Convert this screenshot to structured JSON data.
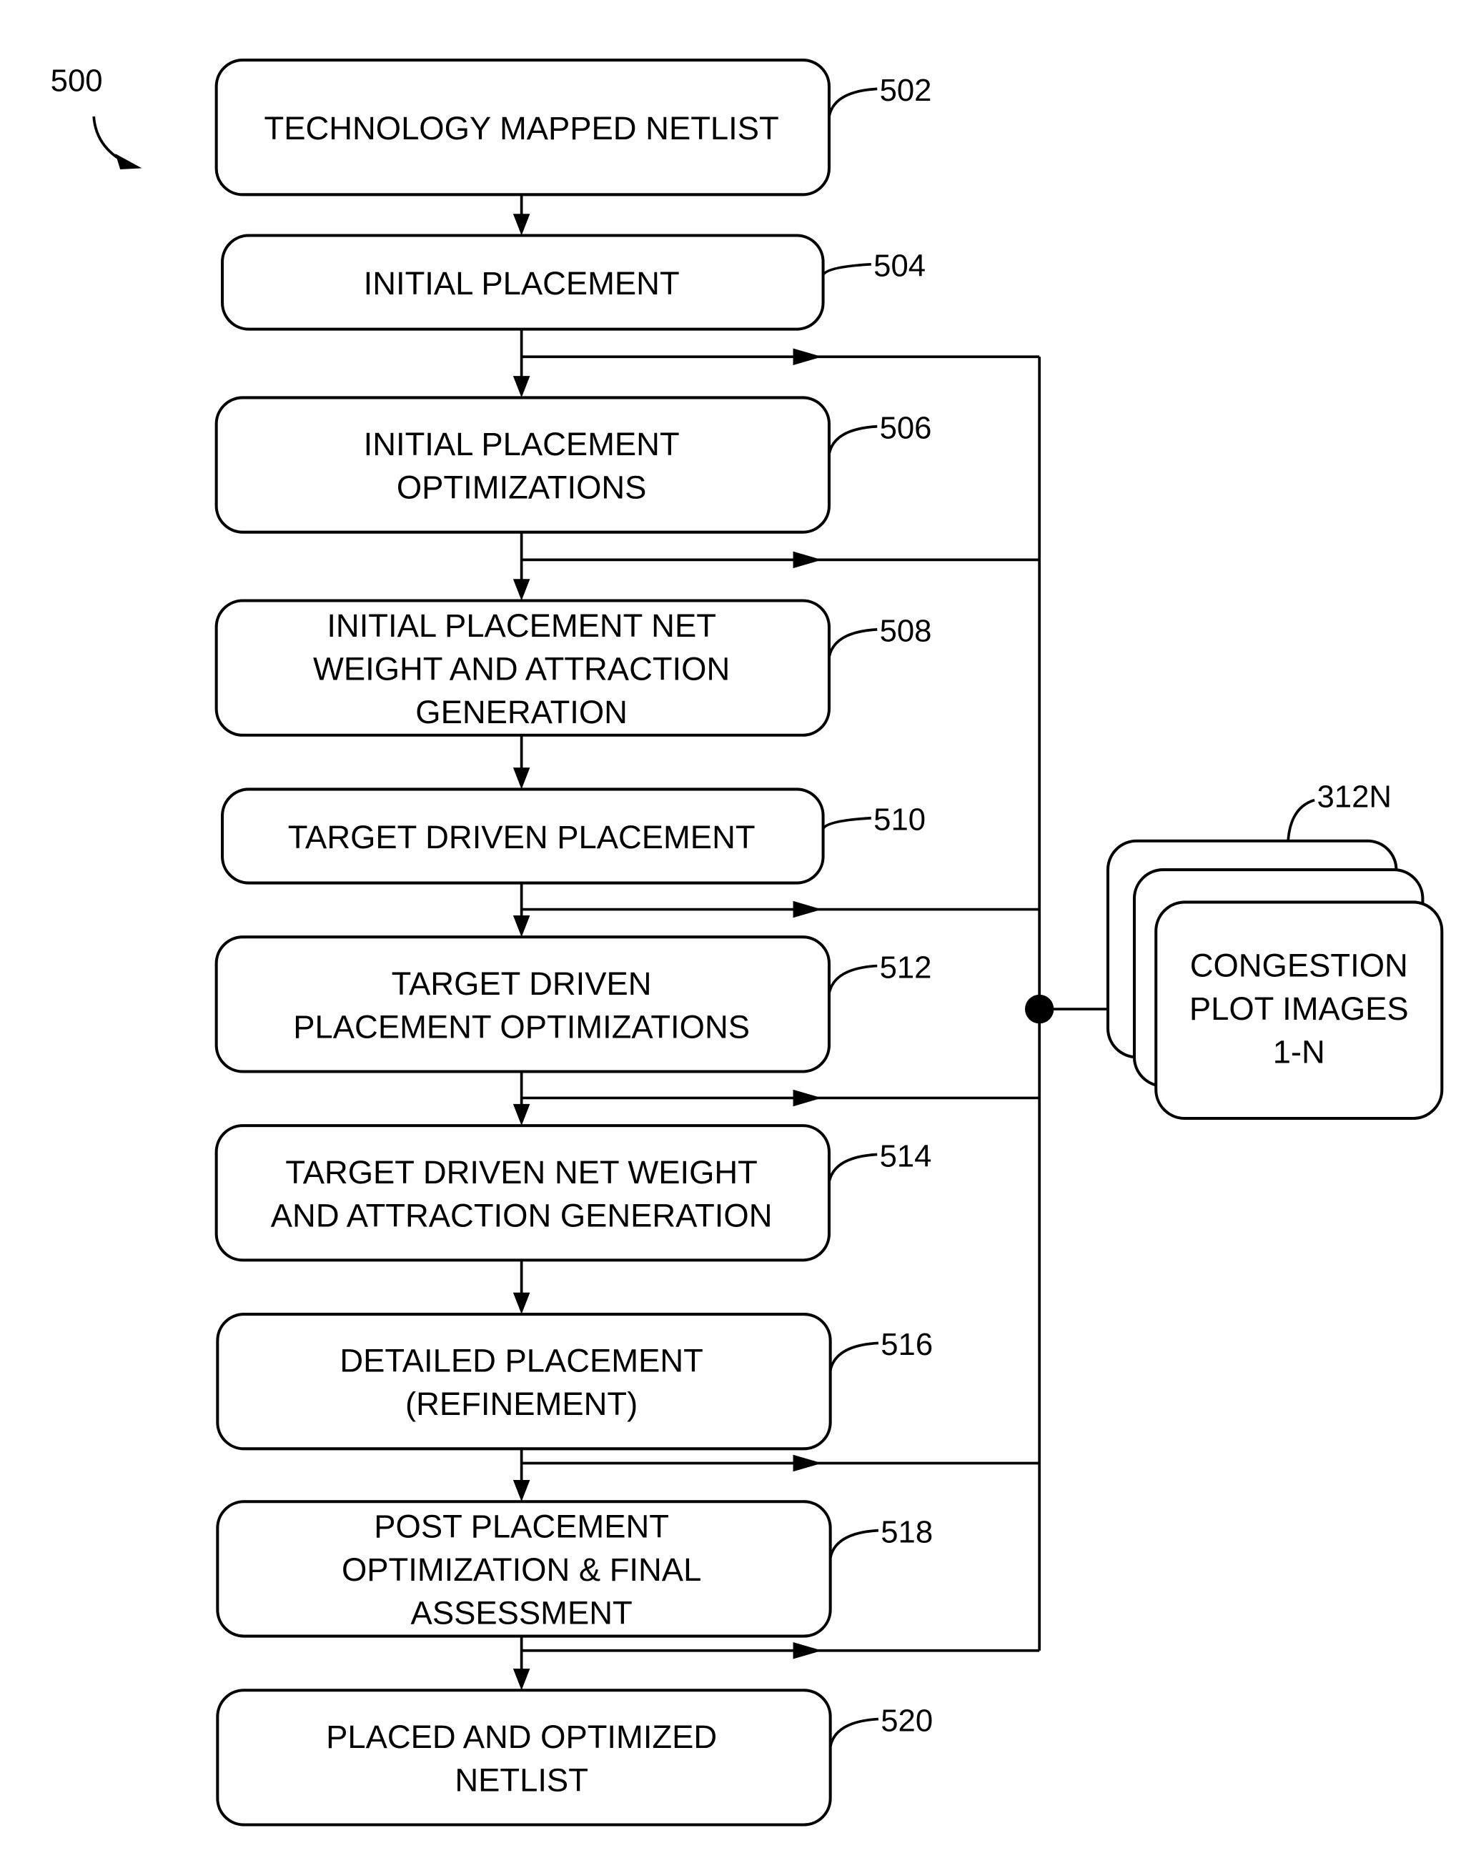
{
  "figure": {
    "number": "500",
    "steps": [
      {
        "ref": "502",
        "lines": [
          "TECHNOLOGY MAPPED NETLIST"
        ]
      },
      {
        "ref": "504",
        "lines": [
          "INITIAL PLACEMENT"
        ]
      },
      {
        "ref": "506",
        "lines": [
          "INITIAL PLACEMENT",
          "OPTIMIZATIONS"
        ]
      },
      {
        "ref": "508",
        "lines": [
          "INITIAL PLACEMENT NET",
          "WEIGHT AND ATTRACTION",
          "GENERATION"
        ]
      },
      {
        "ref": "510",
        "lines": [
          "TARGET DRIVEN PLACEMENT"
        ]
      },
      {
        "ref": "512",
        "lines": [
          "TARGET DRIVEN",
          "PLACEMENT OPTIMIZATIONS"
        ]
      },
      {
        "ref": "514",
        "lines": [
          "TARGET DRIVEN NET WEIGHT",
          "AND ATTRACTION GENERATION"
        ]
      },
      {
        "ref": "516",
        "lines": [
          "DETAILED PLACEMENT",
          "(REFINEMENT)"
        ]
      },
      {
        "ref": "518",
        "lines": [
          "POST PLACEMENT",
          "OPTIMIZATION & FINAL",
          "ASSESSMENT"
        ]
      },
      {
        "ref": "520",
        "lines": [
          "PLACED AND OPTIMIZED",
          "NETLIST"
        ]
      }
    ],
    "output_store": {
      "ref": "312N",
      "lines": [
        "CONGESTION",
        "PLOT IMAGES",
        "1-N"
      ]
    },
    "taps_after_steps": [
      "504",
      "506",
      "510",
      "512",
      "516",
      "518"
    ]
  }
}
